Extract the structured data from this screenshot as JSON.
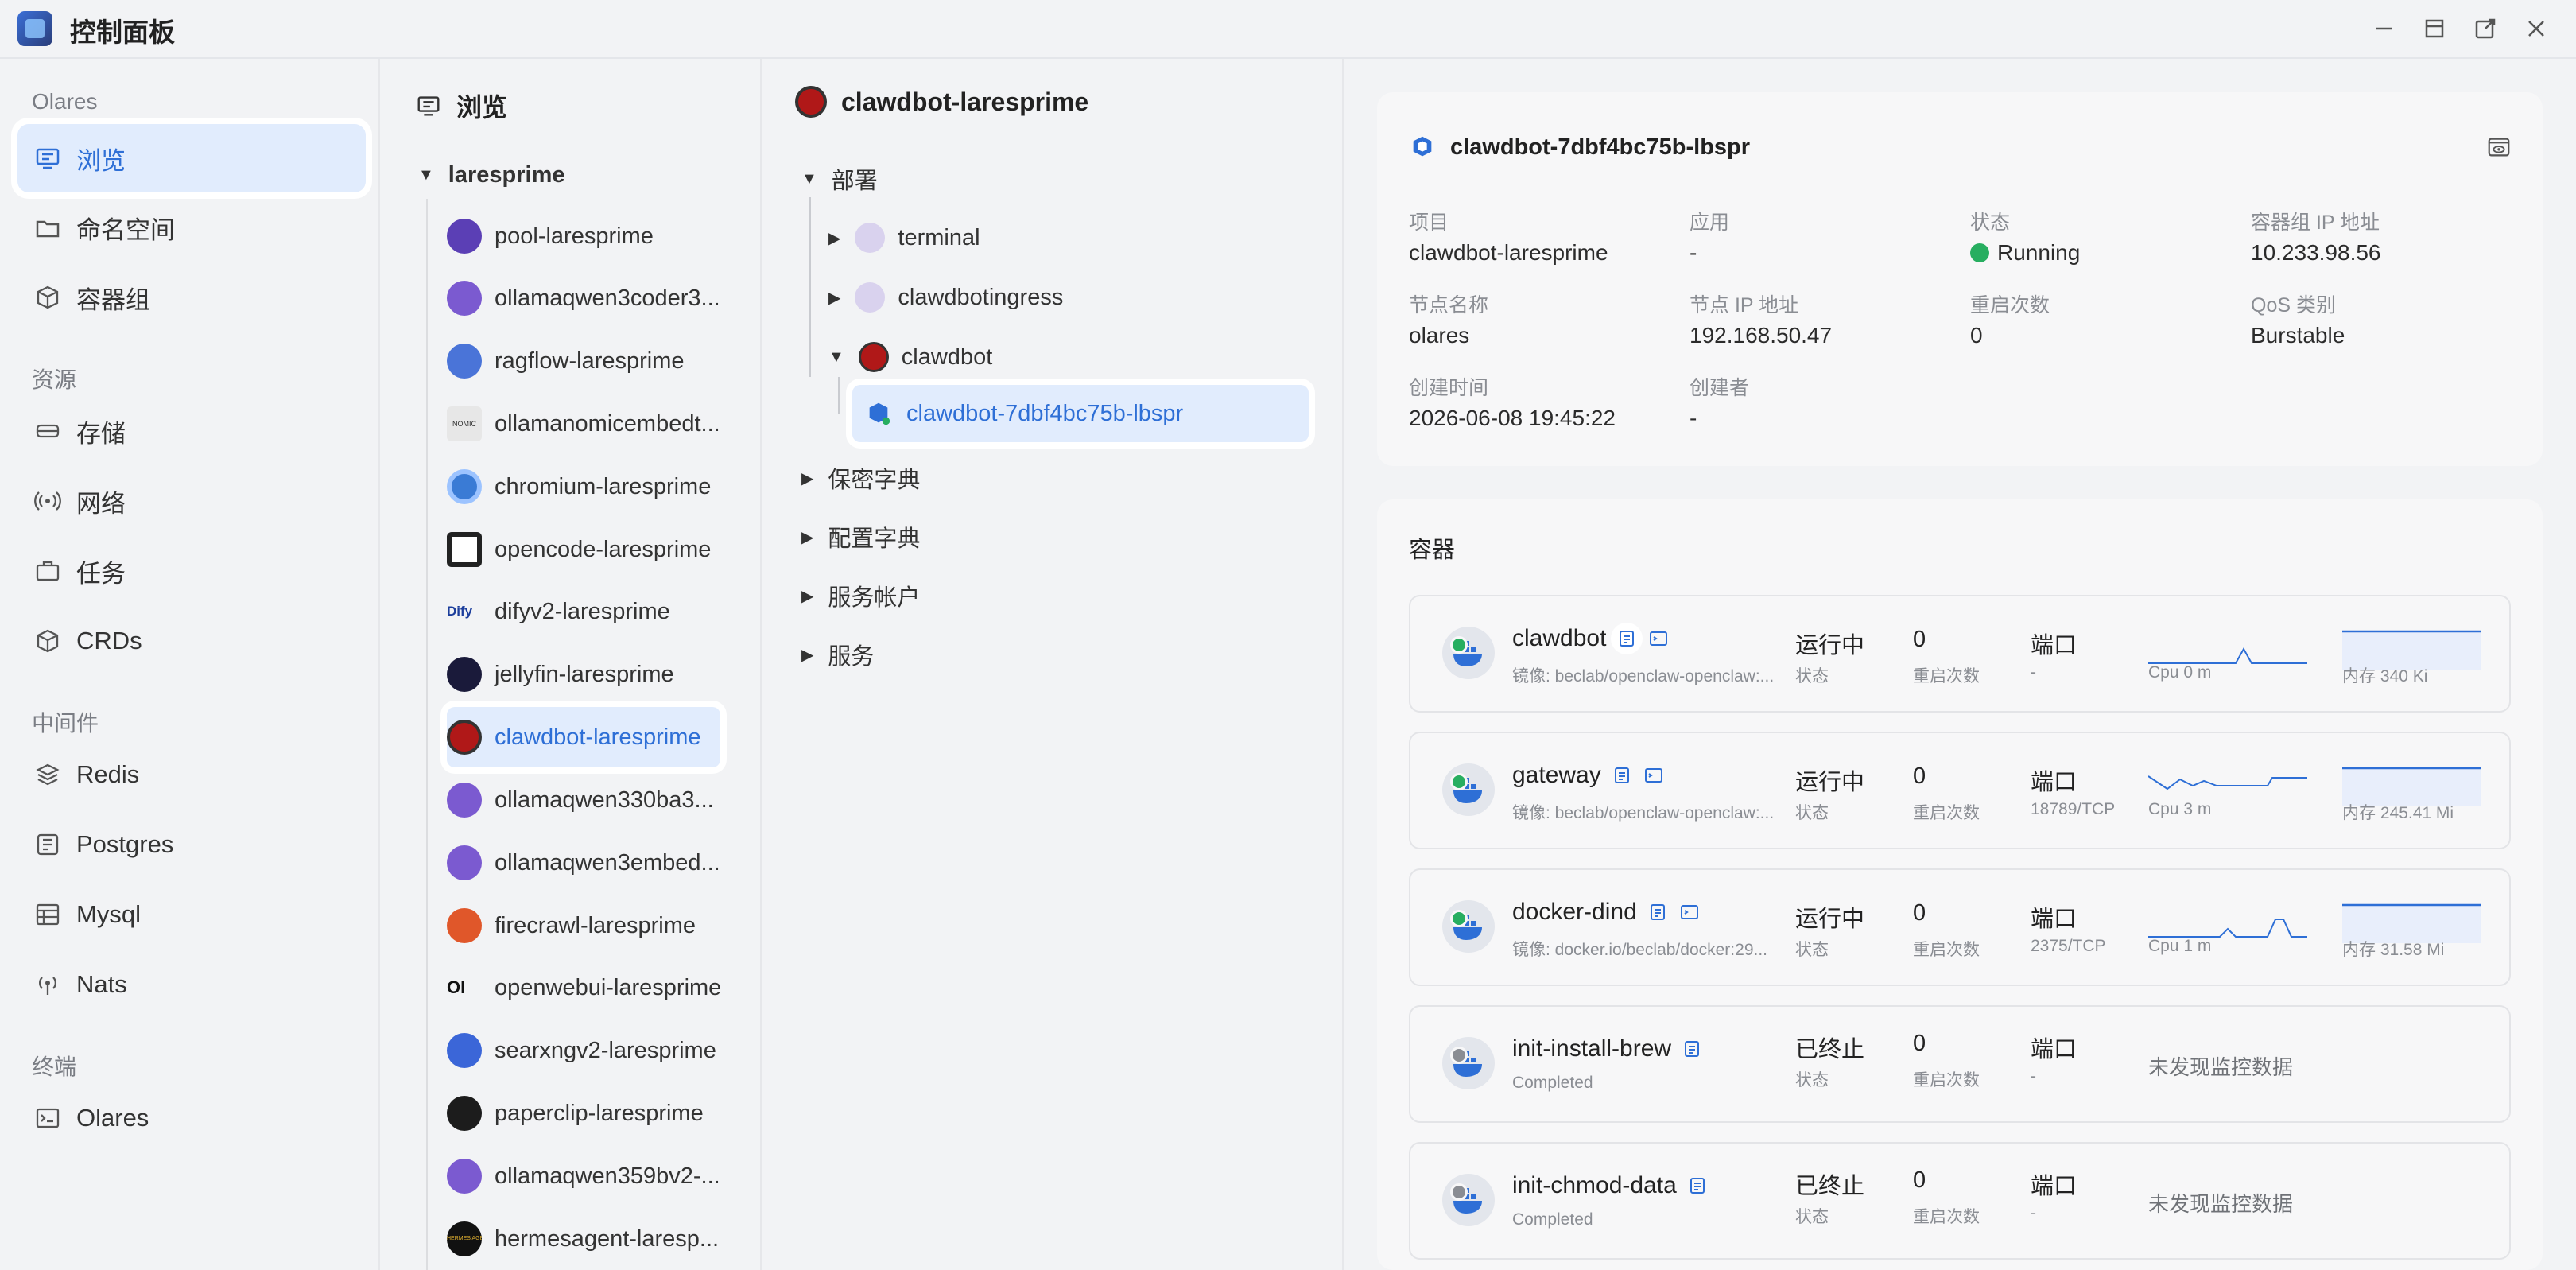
{
  "window": {
    "title": "控制面板"
  },
  "sidebar": {
    "sections": [
      {
        "label": "Olares",
        "items": [
          "浏览",
          "命名空间",
          "容器组"
        ]
      },
      {
        "label": "资源",
        "items": [
          "存储",
          "网络",
          "任务",
          "CRDs"
        ]
      },
      {
        "label": "中间件",
        "items": [
          "Redis",
          "Postgres",
          "Mysql",
          "Nats"
        ]
      },
      {
        "label": "终端",
        "items": [
          "Olares"
        ]
      }
    ]
  },
  "browse": {
    "header": "浏览",
    "user": "laresprime",
    "apps": [
      "pool-laresprime",
      "ollamaqwen3coder3...",
      "ragflow-laresprime",
      "ollamanomicembedt...",
      "chromium-laresprime",
      "opencode-laresprime",
      "difyv2-laresprime",
      "jellyfin-laresprime",
      "clawdbot-laresprime",
      "ollamaqwen330ba3...",
      "ollamaqwen3embed...",
      "firecrawl-laresprime",
      "openwebui-laresprime",
      "searxngv2-laresprime",
      "paperclip-laresprime",
      "ollamaqwen359bv2-...",
      "hermesagent-laresp..."
    ],
    "icon_texts": {
      "difyv2": "Dify",
      "openwebui": "OI",
      "ollamanomic": "NOMIC",
      "hermes": "HERMES AGENT"
    }
  },
  "tree": {
    "header": "clawdbot-laresprime",
    "deploy": "部署",
    "deployments": [
      "terminal",
      "clawdbotingress",
      "clawdbot"
    ],
    "pod": "clawdbot-7dbf4bc75b-lbspr",
    "groups": [
      "保密字典",
      "配置字典",
      "服务帐户",
      "服务"
    ]
  },
  "detail": {
    "title": "clawdbot-7dbf4bc75b-lbspr",
    "fields": [
      {
        "label": "项目",
        "value": "clawdbot-laresprime"
      },
      {
        "label": "应用",
        "value": "-"
      },
      {
        "label": "状态",
        "value": "Running"
      },
      {
        "label": "容器组 IP 地址",
        "value": "10.233.98.56"
      },
      {
        "label": "节点名称",
        "value": "olares"
      },
      {
        "label": "节点 IP 地址",
        "value": "192.168.50.47"
      },
      {
        "label": "重启次数",
        "value": "0"
      },
      {
        "label": "QoS 类别",
        "value": "Burstable"
      },
      {
        "label": "创建时间",
        "value": "2026-06-08 19:45:22"
      },
      {
        "label": "创建者",
        "value": "-"
      }
    ]
  },
  "containers": {
    "title": "容器",
    "status_label": "状态",
    "restart_label": "重启次数",
    "port_label": "端口",
    "no_data": "未发现监控数据",
    "items": [
      {
        "name": "clawdbot",
        "sub": "镜像: beclab/openclaw-openclaw:...",
        "status": "运行中",
        "restarts": "0",
        "port": "-",
        "cpu": "Cpu 0 m",
        "mem": "内存 340 Ki",
        "dot": "#27ae60"
      },
      {
        "name": "gateway",
        "sub": "镜像: beclab/openclaw-openclaw:...",
        "status": "运行中",
        "restarts": "0",
        "port": "18789/TCP",
        "cpu": "Cpu 3 m",
        "mem": "内存 245.41 Mi",
        "dot": "#27ae60"
      },
      {
        "name": "docker-dind",
        "sub": "镜像: docker.io/beclab/docker:29...",
        "status": "运行中",
        "restarts": "0",
        "port": "2375/TCP",
        "cpu": "Cpu 1 m",
        "mem": "内存 31.58 Mi",
        "dot": "#27ae60"
      },
      {
        "name": "init-install-brew",
        "sub": "Completed",
        "status": "已终止",
        "restarts": "0",
        "port": "-",
        "dot": "#8a8d93"
      },
      {
        "name": "init-chmod-data",
        "sub": "Completed",
        "status": "已终止",
        "restarts": "0",
        "port": "-",
        "dot": "#8a8d93"
      }
    ]
  }
}
